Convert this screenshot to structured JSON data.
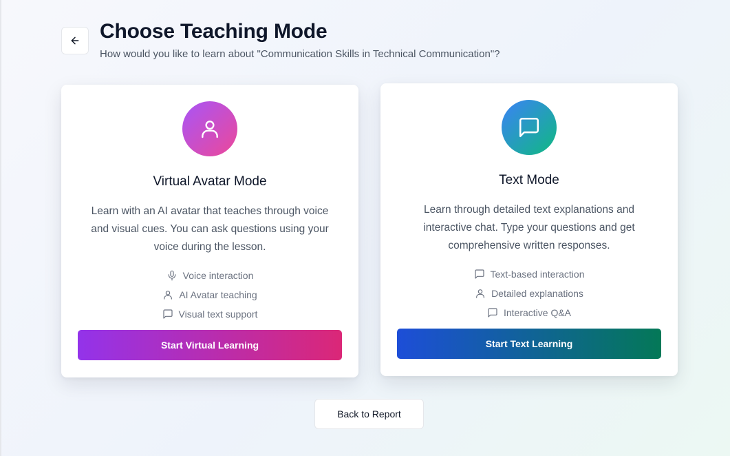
{
  "header": {
    "back_icon": "arrow-left-icon",
    "title": "Choose Teaching Mode",
    "subtitle": "How would you like to learn about \"Communication Skills in Technical Communication\"?"
  },
  "cards": [
    {
      "id": "virtual-avatar",
      "icon": "user-icon",
      "title": "Virtual Avatar Mode",
      "description": "Learn with an AI avatar that teaches through voice and visual cues. You can ask questions using your voice during the lesson.",
      "features": [
        {
          "icon": "microphone-icon",
          "label": "Voice interaction"
        },
        {
          "icon": "user-icon",
          "label": "AI Avatar teaching"
        },
        {
          "icon": "message-square-icon",
          "label": "Visual text support"
        }
      ],
      "button_label": "Start Virtual Learning",
      "gradient": [
        "#9333ea",
        "#db2777"
      ]
    },
    {
      "id": "text",
      "icon": "message-square-icon",
      "title": "Text Mode",
      "description": "Learn through detailed text explanations and interactive chat. Type your questions and get comprehensive written responses.",
      "features": [
        {
          "icon": "message-square-icon",
          "label": "Text-based interaction"
        },
        {
          "icon": "user-icon",
          "label": "Detailed explanations"
        },
        {
          "icon": "message-square-icon",
          "label": "Interactive Q&A"
        }
      ],
      "button_label": "Start Text Learning",
      "gradient": [
        "#1d4ed8",
        "#047857"
      ]
    }
  ],
  "footer": {
    "back_to_report_label": "Back to Report"
  }
}
